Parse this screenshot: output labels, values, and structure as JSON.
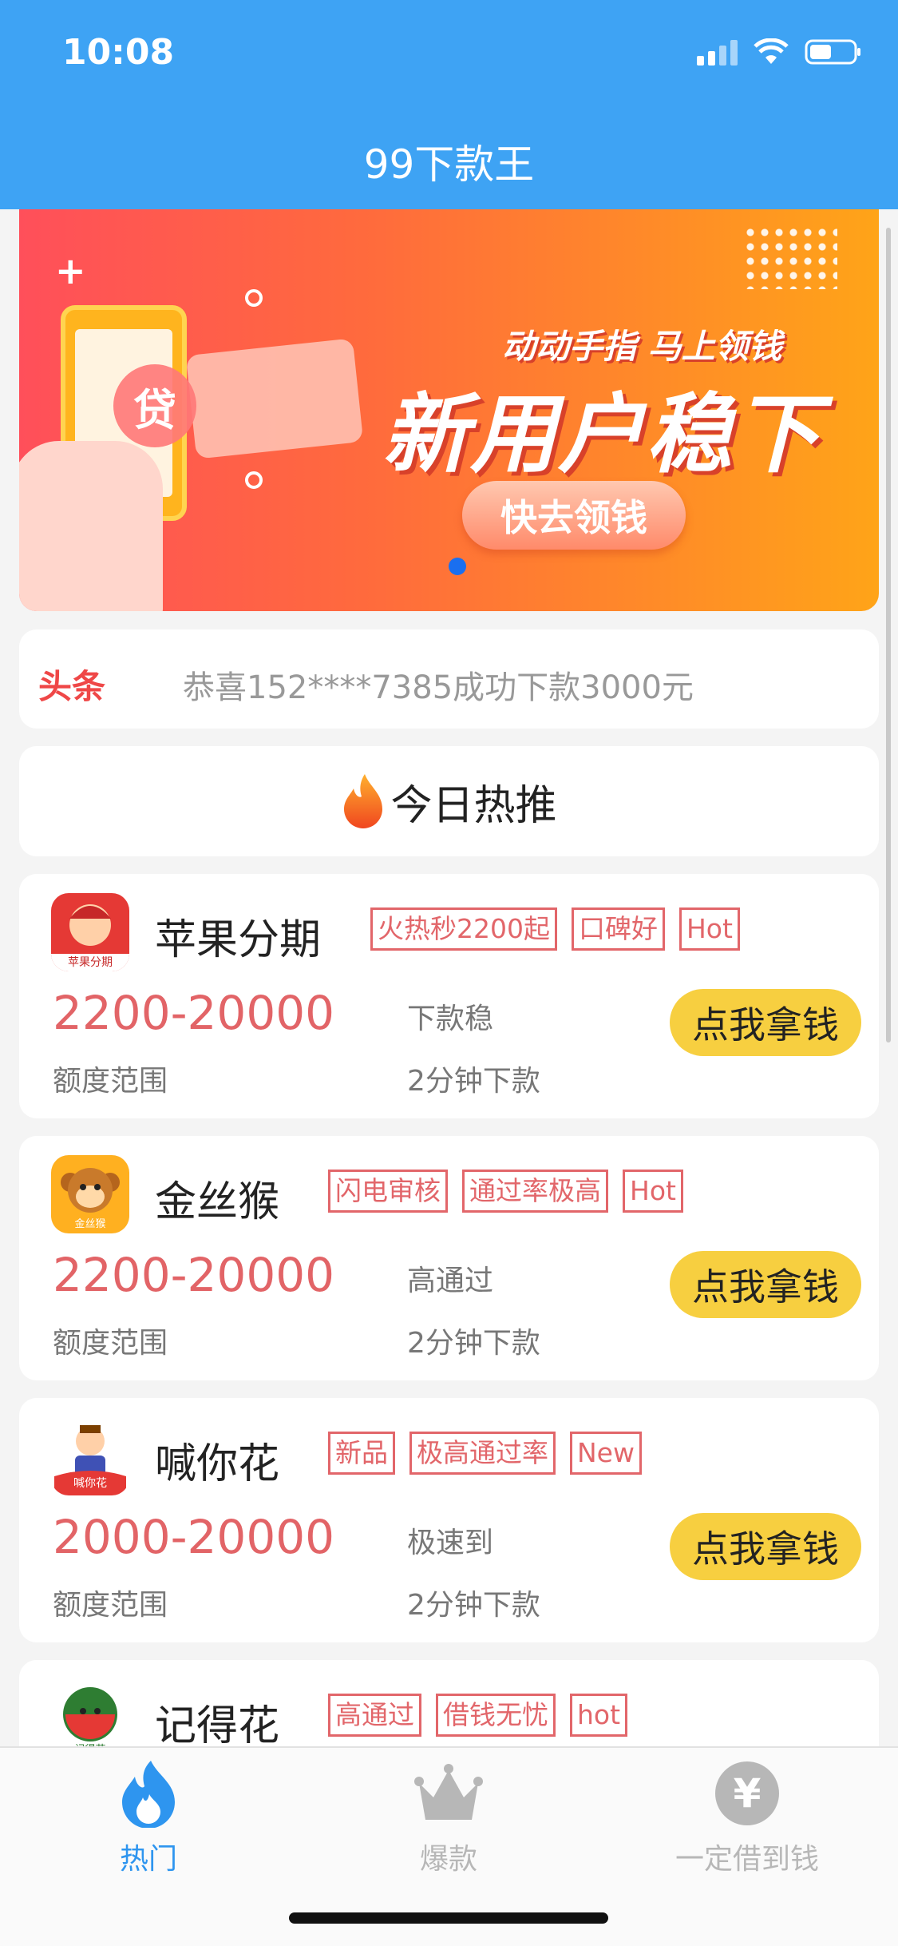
{
  "status_bar": {
    "time": "10:08"
  },
  "header": {
    "title": "99下款王"
  },
  "banner": {
    "slogan_small": "动动手指 马上领钱",
    "slogan_big": "新用户稳下",
    "button": "快去领钱",
    "loan_char": "贷",
    "plus": "+"
  },
  "notice": {
    "label": "头条",
    "text": "恭喜152****7385成功下款3000元"
  },
  "hot": {
    "title": "今日热推"
  },
  "products": [
    {
      "name": "苹果分期",
      "tags": [
        "火热秒2200起",
        "口碑好",
        "Hot"
      ],
      "amount": "2200-20000",
      "amount_label": "额度范围",
      "feature": "下款稳",
      "time": "2分钟下款",
      "cta": "点我拿钱",
      "logo_text": "苹果分期"
    },
    {
      "name": "金丝猴",
      "tags": [
        "闪电审核",
        "通过率极高",
        "Hot"
      ],
      "amount": "2200-20000",
      "amount_label": "额度范围",
      "feature": "高通过",
      "time": "2分钟下款",
      "cta": "点我拿钱",
      "logo_text": "金丝猴"
    },
    {
      "name": "喊你花",
      "tags": [
        "新品",
        "极高通过率",
        "New"
      ],
      "amount": "2000-20000",
      "amount_label": "额度范围",
      "feature": "极速到",
      "time": "2分钟下款",
      "cta": "点我拿钱",
      "logo_text": "喊你花"
    },
    {
      "name": "记得花",
      "tags": [
        "高通过",
        "借钱无忧",
        "hot"
      ],
      "amount": "",
      "amount_label": "",
      "feature": "",
      "time": "",
      "cta": "",
      "logo_text": "记得花"
    }
  ],
  "tabbar": {
    "tabs": [
      {
        "label": "热门",
        "icon": "flame-icon",
        "active": true
      },
      {
        "label": "爆款",
        "icon": "crown-icon",
        "active": false
      },
      {
        "label": "一定借到钱",
        "icon": "yen-icon",
        "active": false
      }
    ]
  },
  "colors": {
    "header_bg": "#3ea3f4",
    "accent_red": "#e26467",
    "cta_yellow": "#f7cf40",
    "tab_active": "#2e95ef",
    "tab_inactive": "#b7b7b7"
  }
}
